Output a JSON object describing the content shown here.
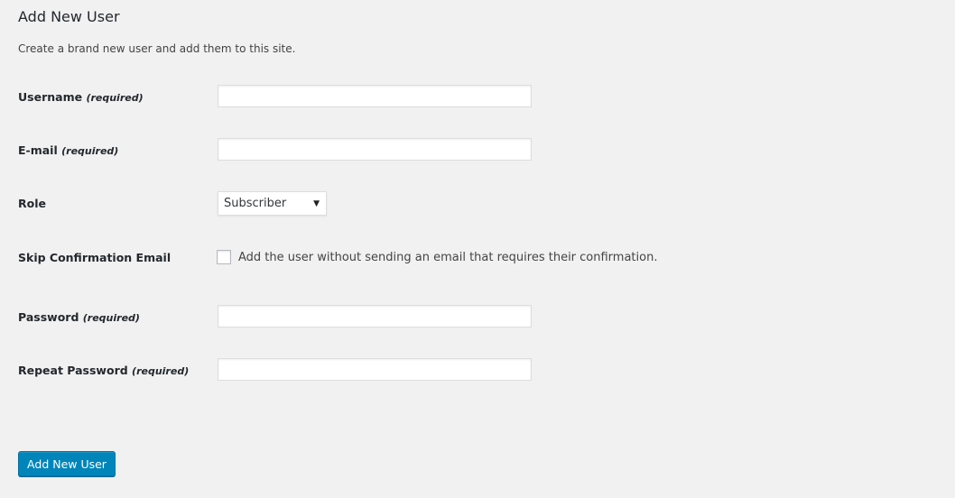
{
  "header": {
    "title": "Add New User",
    "description": "Create a brand new user and add them to this site."
  },
  "form": {
    "required_marker": "(required)",
    "username": {
      "label": "Username",
      "value": "",
      "placeholder": ""
    },
    "email": {
      "label": "E-mail",
      "value": "",
      "placeholder": ""
    },
    "role": {
      "label": "Role",
      "selected": "Subscriber"
    },
    "skip_confirmation": {
      "label": "Skip Confirmation Email",
      "checkbox_text": "Add the user without sending an email that requires their confirmation.",
      "checked": false
    },
    "password": {
      "label": "Password",
      "value": "",
      "placeholder": ""
    },
    "repeat_password": {
      "label": "Repeat Password",
      "value": "",
      "placeholder": ""
    },
    "submit_label": "Add New User"
  },
  "colors": {
    "background": "#f1f1f1",
    "primary_button": "#0085ba",
    "input_border": "#ddd"
  },
  "icons": {
    "select_arrow": "chevron-down-icon"
  }
}
